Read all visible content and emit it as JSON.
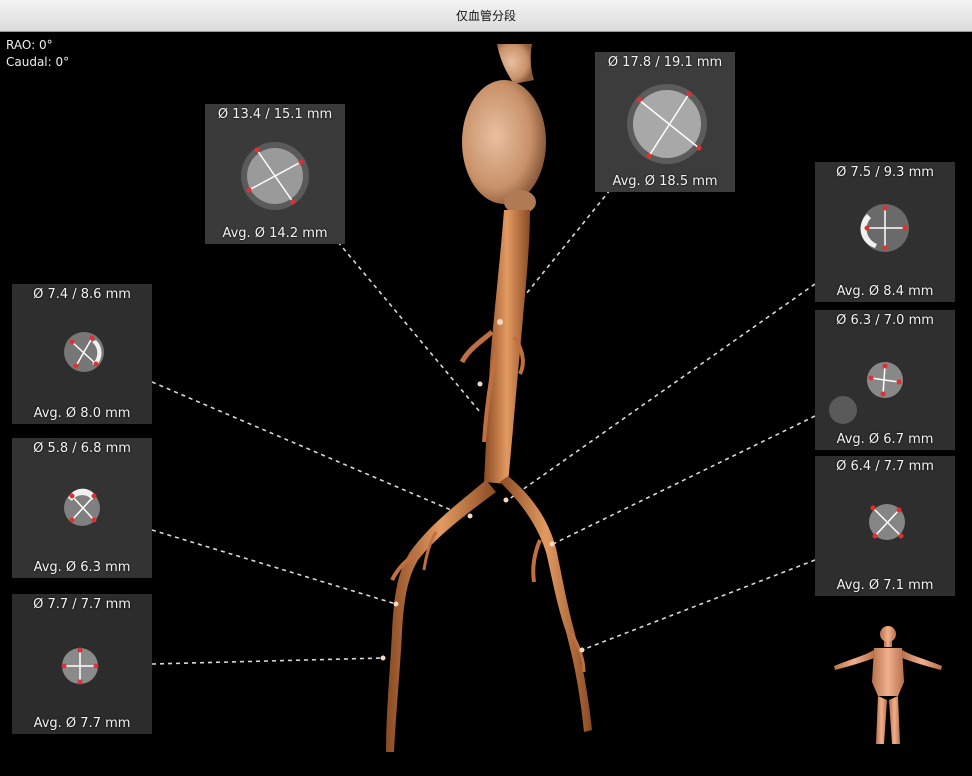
{
  "window": {
    "title": "仅血管分段"
  },
  "orientation": {
    "rao": "RAO: 0°",
    "caudal": "Caudal: 0°"
  },
  "colors": {
    "vessel": "#c8763e",
    "vessel_light": "#e0a070",
    "aneurysm": "#cfa07a",
    "marker": "#e03030",
    "leader": "#d8d8d8"
  },
  "cross_sections": [
    {
      "id": "aorta-upper",
      "diameters": "Ø 13.4 / 15.1 mm",
      "average": "Avg. Ø 14.2 mm"
    },
    {
      "id": "aneurysm",
      "diameters": "Ø 17.8 / 19.1 mm",
      "average": "Avg. Ø 18.5 mm"
    },
    {
      "id": "right-common-iliac",
      "diameters": "Ø 7.4 / 8.6 mm",
      "average": "Avg. Ø 8.0 mm"
    },
    {
      "id": "right-external-iliac",
      "diameters": "Ø 5.8 / 6.8 mm",
      "average": "Avg. Ø 6.3 mm"
    },
    {
      "id": "right-femoral",
      "diameters": "Ø 7.7 / 7.7 mm",
      "average": "Avg. Ø 7.7 mm"
    },
    {
      "id": "left-common-iliac",
      "diameters": "Ø 7.5 / 9.3 mm",
      "average": "Avg. Ø 8.4 mm"
    },
    {
      "id": "left-external-iliac",
      "diameters": "Ø 6.3 / 7.0 mm",
      "average": "Avg. Ø 6.7 mm"
    },
    {
      "id": "left-femoral",
      "diameters": "Ø 6.4 / 7.7 mm",
      "average": "Avg. Ø 7.1 mm"
    }
  ],
  "icons": {
    "orientation_figure": "human-body-icon"
  }
}
